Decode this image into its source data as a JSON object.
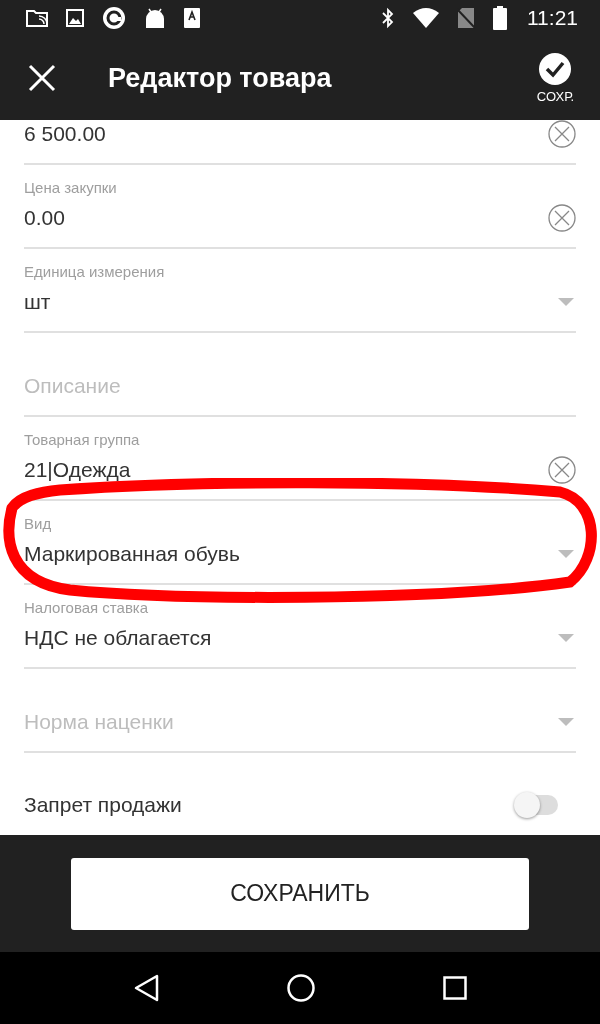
{
  "status_bar": {
    "time": "11:21"
  },
  "toolbar": {
    "title": "Редактор товара",
    "action_label": "СОХР."
  },
  "fields": [
    {
      "kind": "field",
      "value": "6 500.00",
      "clear_button": true
    },
    {
      "kind": "field",
      "label": "Цена закупки",
      "value": "0.00",
      "clear_button": true
    },
    {
      "kind": "field",
      "label": "Единица измерения",
      "value": "шт",
      "dropdown": true
    },
    {
      "kind": "field",
      "placeholder": "Описание"
    },
    {
      "kind": "field",
      "label": "Товарная группа",
      "value": "21|Одежда",
      "clear_button": true
    },
    {
      "kind": "field",
      "label": "Вид",
      "value": "Маркированная обувь",
      "dropdown": true
    },
    {
      "kind": "field",
      "label": "Налоговая ставка",
      "value": "НДС не облагается",
      "dropdown": true
    },
    {
      "kind": "field",
      "placeholder": "Норма наценки",
      "dropdown": true
    },
    {
      "kind": "toggle",
      "label": "Запрет продажи",
      "on": false
    }
  ],
  "annotation": {
    "kind": "ellipse",
    "color": "#ff0000"
  },
  "save_button": {
    "label": "СОХРАНИТЬ"
  }
}
